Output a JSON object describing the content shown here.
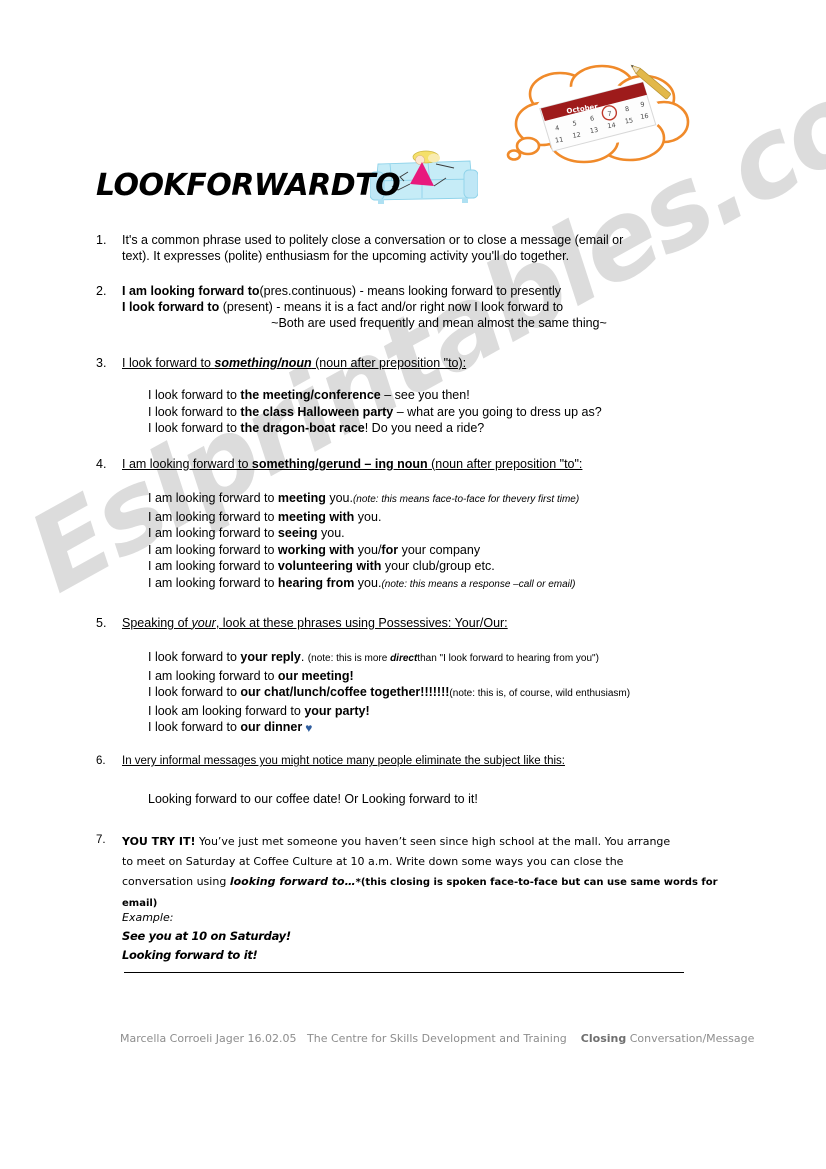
{
  "title": "LOOKFORWARDTO",
  "watermark": "Eslprintables.com",
  "clipart": {
    "thought_bubble": "thought-bubble-calendar-clipart",
    "couch": "person-on-couch-clipart",
    "bubble_outline_color": "#f08a2a",
    "calendar_band_color": "#9e1b1b",
    "couch_color": "#c6ecf7",
    "couch_shadow_color": "#a9dff0",
    "dress_color": "#e8197d",
    "hair_color": "#f5e06a"
  },
  "items": [
    {
      "num": "1.",
      "line1": "It's a common phrase used to politely close a conversation or to close a message (email or",
      "line2": "text). It expresses (polite) enthusiasm for the upcoming activity you'll do together."
    },
    {
      "num": "2.",
      "bold1": "I am looking forward to",
      "rest1": "(pres.continuous) - means looking forward to presently",
      "bold2": "I look forward to",
      "rest2": " (present) - means it is a fact and/or right now I look forward to",
      "center": "~Both are used frequently and mean almost the same thing~"
    },
    {
      "num": "3.",
      "head_pre": "I look forward to ",
      "head_bi": "something/noun",
      "head_post": " (noun after preposition \"to):",
      "examples": [
        {
          "pre": "I look forward to ",
          "bold": "the meeting/conference",
          "post": " – see you then!"
        },
        {
          "pre": "I look forward to ",
          "bold": "the class Halloween party",
          "post": " – what are you going to dress up as?"
        },
        {
          "pre": "I look forward to ",
          "bold": "the dragon-boat race",
          "post": "! Do you need a ride?"
        }
      ]
    },
    {
      "num": "4.",
      "head_pre": "I am looking forward to ",
      "head_bi": "something/gerund – ing noun",
      "head_post": " (noun  after preposition \"to\":",
      "examples": [
        {
          "pre": "I am looking forward to ",
          "bold": "meeting",
          "post": " you.",
          "note": "(note: this means face-to-face for thevery first time)"
        },
        {
          "pre": "I am looking forward to ",
          "bold": "meeting with",
          "post": " you."
        },
        {
          "pre": "I am looking forward to ",
          "bold": "seeing",
          "post": " you."
        },
        {
          "pre": "I am looking forward to ",
          "bold": "working with",
          "post": " you/",
          "bold2": "for",
          "post2": " your company"
        },
        {
          "pre": "I am looking forward to ",
          "bold": "volunteering with",
          "post": " your club/group etc."
        },
        {
          "pre": "I am looking forward to ",
          "bold": "hearing from",
          "post": " you.",
          "note": "(note: this means a response –call or email)"
        }
      ]
    },
    {
      "num": "5.",
      "head_pre": "Speaking of ",
      "head_i": "your",
      "head_post": ", look at these phrases using Possessives: Your/Our:",
      "examples": [
        {
          "pre": "I look forward to ",
          "bold": "your reply",
          "post": ". ",
          "note_pre": "(note: this is more ",
          "note_bi": "direct",
          "note_post": "than \"I look forward to  hearing from you\")"
        },
        {
          "pre": "I am looking forward to ",
          "bold": "our meeting!"
        },
        {
          "pre": "I look forward to ",
          "bold": "our chat/lunch/coffee together!!!!!!!",
          "note_plain": "(note: this is, of course, wild enthusiasm)"
        },
        {
          "pre": "I look am looking forward to ",
          "bold": "your party!"
        },
        {
          "pre": "I look forward to ",
          "bold": "our dinner",
          "heart": "♥"
        }
      ]
    },
    {
      "num": "6.",
      "head": "In very informal messages you might notice many people eliminate the subject like this:",
      "line": "Looking forward to our coffee date!        Or     Looking forward to it!"
    },
    {
      "num": "7.",
      "bold_lead": "YOU TRY IT!",
      "line1": "  You’ve just met someone you haven’t seen since high school at the mall. You arrange",
      "line2": "to meet on Saturday at Coffee Culture at 10 a.m. Write down some ways you can close the",
      "line3_pre": "conversation using ",
      "line3_bi": "looking forward to…",
      "line3_post": "*(this closing is spoken face-to-face but can use same words for email)"
    }
  ],
  "example_block": {
    "label": "Example:",
    "line1": "See you at 10 on Saturday!",
    "line2": "Looking forward to it!"
  },
  "footer": {
    "author": "Marcella Corroeli Jager 16.02.05",
    "org": "The Centre for Skills Development and Training",
    "tag_bold": "Closing",
    "tag_rest": " Conversation/Message"
  }
}
